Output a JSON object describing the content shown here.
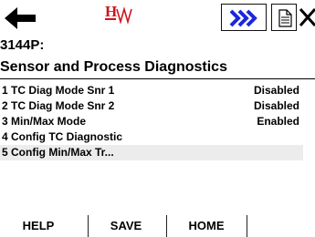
{
  "toolbar": {
    "back_icon": "left-arrow-icon",
    "logo_text": "H",
    "logo_color": "#d0141c",
    "next_icon": "double-chevron-right-icon",
    "next_color": "#1b27d8",
    "doc_icon": "document-icon",
    "close_icon": "close-icon"
  },
  "header": {
    "device_id": "3144P:",
    "title": "Sensor and Process Diagnostics"
  },
  "menu": {
    "items": [
      {
        "label": "1 TC Diag Mode Snr 1",
        "value": "Disabled"
      },
      {
        "label": "2 TC Diag Mode Snr 2",
        "value": "Disabled"
      },
      {
        "label": "3 Min/Max Mode",
        "value": "Enabled"
      },
      {
        "label": "4 Config TC Diagnostic",
        "value": ""
      },
      {
        "label": "5 Config Min/Max Tr...",
        "value": ""
      }
    ],
    "selected_index": 4
  },
  "footer": {
    "help_label": "HELP",
    "save_label": "SAVE",
    "home_label": "HOME"
  }
}
